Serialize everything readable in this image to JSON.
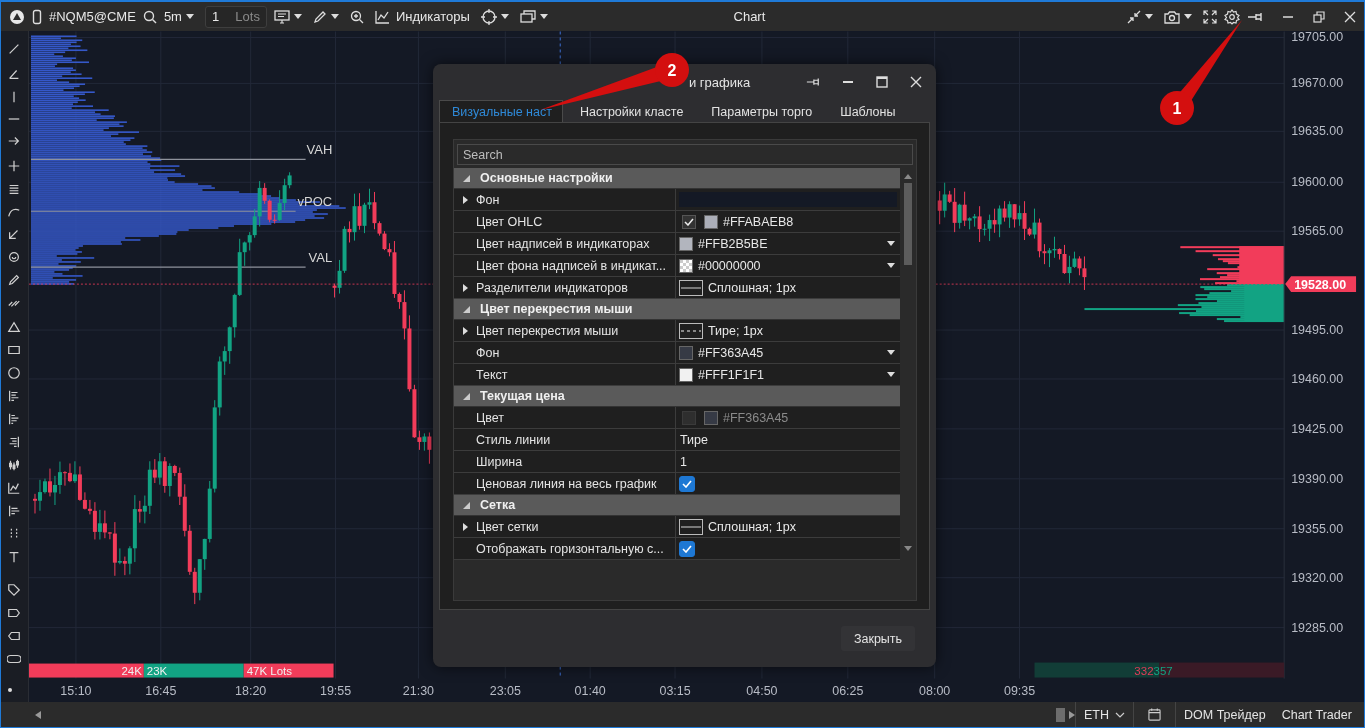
{
  "window": {
    "title": "Chart"
  },
  "toolbar": {
    "symbol": "#NQM5@CME",
    "timeframe": "5m",
    "quantity": "1",
    "quantity_unit": "Lots",
    "indicators": "Индикаторы"
  },
  "price_axis": {
    "labels": [
      "19705.00",
      "19670.00",
      "19635.00",
      "19600.00",
      "19565.00",
      "19495.00",
      "19460.00",
      "19425.00",
      "19390.00",
      "19355.00",
      "19320.00",
      "19285.00"
    ],
    "current_price": "19528.00"
  },
  "time_axis": [
    "15:10",
    "16:45",
    "18:20",
    "19:55",
    "21:30",
    "23:05",
    "01:40",
    "03:15",
    "04:50",
    "06:25",
    "08:00",
    "09:35"
  ],
  "profile_labels": [
    "VAH",
    "vPOC",
    "VAL"
  ],
  "volume_bar": [
    {
      "text": "24K",
      "color": "#f23c5a"
    },
    {
      "text": "23K",
      "color": "#12a383"
    },
    {
      "text": "47K Lots",
      "color": "#f23c5a"
    }
  ],
  "delta_bar": {
    "sell": "332",
    "buy": "357"
  },
  "dialog": {
    "title": "и графика",
    "tabs": [
      {
        "label": "Визуальные наст",
        "selected": true
      },
      {
        "label": "Настройки класте",
        "selected": false
      },
      {
        "label": "Параметры торго",
        "selected": false
      },
      {
        "label": "Шаблоны",
        "selected": false
      }
    ],
    "search": {
      "placeholder": "Search"
    },
    "groups": [
      {
        "title": "Основные настройки",
        "expanded": true,
        "rows": [
          {
            "label": "Фон",
            "kind": "bar",
            "has_children": true,
            "color": "#141925"
          },
          {
            "label": "Цвет OHLC",
            "kind": "check-color",
            "has_children": false,
            "checked": true,
            "disabled": false,
            "color": "#abaeb8",
            "value": "#FFABAEB8"
          },
          {
            "label": "Цвет надписей в индикаторах",
            "kind": "color",
            "has_children": false,
            "color": "#b2b5be",
            "transparent": false,
            "value": "#FFB2B5BE",
            "dropdown": true
          },
          {
            "label": "Цвет фона надписей в индикат...",
            "kind": "color",
            "has_children": false,
            "transparent": true,
            "value": "#00000000",
            "dropdown": true
          },
          {
            "label": "Разделители индикаторов",
            "kind": "line",
            "has_children": true,
            "dashed": false,
            "value": "Сплошная; 1px"
          }
        ]
      },
      {
        "title": "Цвет перекрестия мыши",
        "expanded": true,
        "rows": [
          {
            "label": "Цвет перекрестия мыши",
            "kind": "line",
            "has_children": true,
            "dashed": true,
            "value": "Тире; 1px"
          },
          {
            "label": "Фон",
            "kind": "color",
            "has_children": false,
            "color": "#363a45",
            "transparent": false,
            "value": "#FF363A45",
            "dropdown": true
          },
          {
            "label": "Текст",
            "kind": "color",
            "has_children": false,
            "color": "#f1f1f1",
            "transparent": false,
            "value": "#FFF1F1F1",
            "dropdown": true
          }
        ]
      },
      {
        "title": "Текущая цена",
        "expanded": true,
        "rows": [
          {
            "label": "Цвет",
            "kind": "check-color",
            "has_children": false,
            "checked": false,
            "disabled": true,
            "color": "#363a45",
            "value": "#FF363A45"
          },
          {
            "label": "Стиль линии",
            "kind": "text",
            "has_children": false,
            "value": "Тире"
          },
          {
            "label": "Ширина",
            "kind": "text",
            "has_children": false,
            "value": "1"
          },
          {
            "label": "Ценовая линия на весь график",
            "kind": "checkbox",
            "has_children": false,
            "checked": true
          }
        ]
      },
      {
        "title": "Сетка",
        "expanded": true,
        "rows": [
          {
            "label": "Цвет сетки",
            "kind": "line",
            "has_children": true,
            "dashed": false,
            "value": "Сплошная; 1px"
          },
          {
            "label": "Отображать горизонтальную с...",
            "kind": "checkbox",
            "has_children": false,
            "checked": true
          }
        ]
      }
    ],
    "close_button": "Закрыть"
  },
  "status_bar": {
    "session": "ETH",
    "buttons": [
      "DOM Трейдер",
      "Chart Trader"
    ]
  },
  "callouts": [
    {
      "number": "1"
    },
    {
      "number": "2"
    }
  ]
}
